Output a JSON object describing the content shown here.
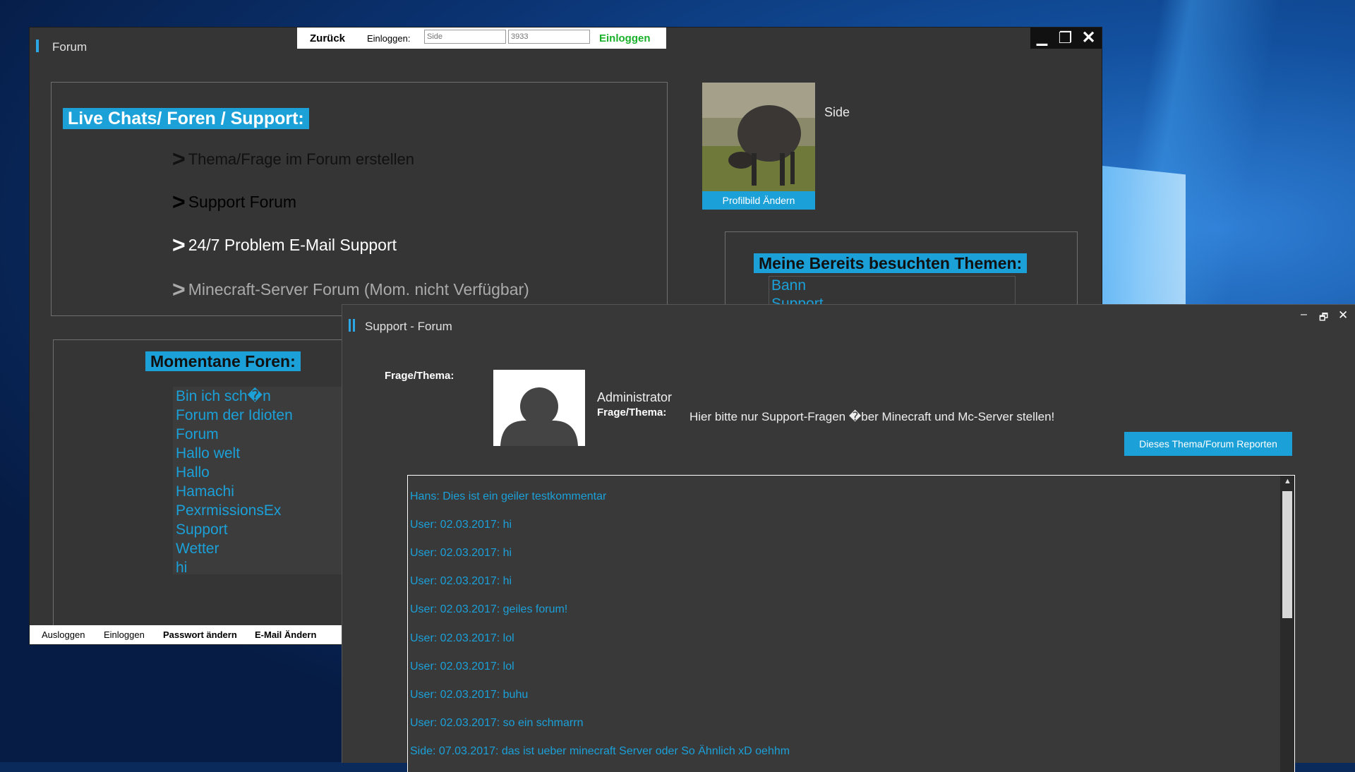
{
  "forum_window": {
    "title": "Forum",
    "login_bar": {
      "back": "Zurück",
      "login_label": "Einloggen:",
      "username_placeholder": "Side",
      "password_placeholder": "3933",
      "login_button": "Einloggen"
    },
    "controls": {
      "minimize": "▁",
      "maximize": "❐",
      "close": "✕"
    },
    "live_chats": {
      "header": "Live Chats/ Foren / Support:",
      "items": [
        "Thema/Frage im Forum erstellen",
        "Support Forum",
        "24/7 Problem E-Mail  Support",
        "Minecraft-Server Forum (Mom. nicht Verfügbar)"
      ]
    },
    "current_forums": {
      "header": "Momentane Foren:",
      "items": [
        "Bin ich sch�n",
        "Forum der Idioten",
        "Forum",
        "Hallo welt",
        "Hallo",
        "Hamachi",
        "PexrmissionsEx",
        "Support",
        "Wetter",
        "hi"
      ]
    },
    "profile": {
      "name": "Side",
      "change_picture": "Profilbild Ändern"
    },
    "visited": {
      "header": "Meine Bereits  besuchten Themen:",
      "items": [
        "Bann",
        "Support"
      ]
    },
    "bottom_bar": {
      "logout": "Ausloggen",
      "login": "Einloggen",
      "change_password": "Passwort ändern",
      "change_email": "E-Mail Ändern"
    }
  },
  "support_window": {
    "title": "Support - Forum",
    "controls": {
      "minimize": "–",
      "maximize": "🗗",
      "close": "✕"
    },
    "question_label": "Frage/Thema:",
    "author": "Administrator",
    "question_label2": "Frage/Thema:",
    "question_text": "Hier bitte nur Support-Fragen �ber Minecraft und Mc-Server stellen!",
    "report_button": "Dieses Thema/Forum Reporten",
    "comments": [
      "Hans: Dies ist ein geiler testkommentar",
      "User: 02.03.2017: hi",
      "User: 02.03.2017: hi",
      "User: 02.03.2017: hi",
      "User: 02.03.2017: geiles forum!",
      "User: 02.03.2017: lol",
      "User: 02.03.2017: lol",
      "User: 02.03.2017: buhu",
      "User: 02.03.2017: so ein schmarrn",
      "Side: 07.03.2017: das ist ueber minecraft Server oder So Ähnlich xD oehhm"
    ]
  },
  "colors": {
    "accent": "#1ba0d8",
    "window_bg": "#353535",
    "login_green": "#19b02a"
  }
}
